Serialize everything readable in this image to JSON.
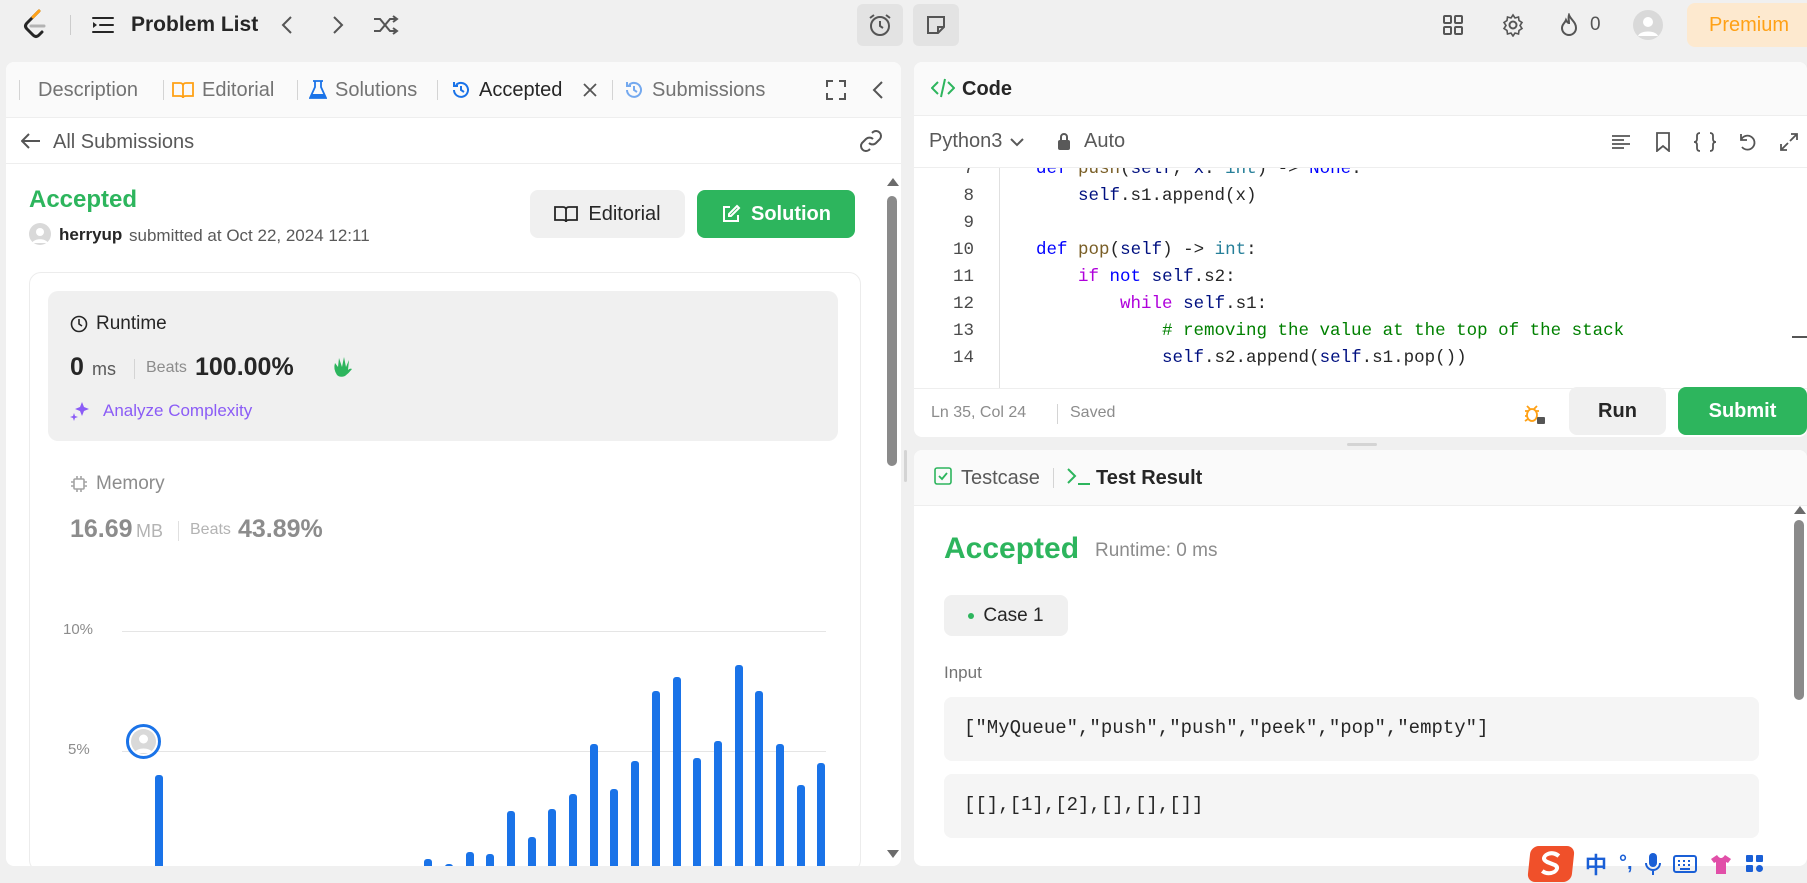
{
  "topbar": {
    "title": "Problem List",
    "streak": "0",
    "premium": "Premium"
  },
  "left_tabs": {
    "description": "Description",
    "editorial": "Editorial",
    "solutions": "Solutions",
    "accepted": "Accepted",
    "submissions": "Submissions"
  },
  "back": {
    "label": "All Submissions"
  },
  "submission": {
    "status": "Accepted",
    "user": "herryup",
    "submitted_text": "submitted at Oct 22, 2024 12:11",
    "editorial_btn": "Editorial",
    "solution_btn": "Solution"
  },
  "runtime": {
    "label": "Runtime",
    "value": "0",
    "unit": "ms",
    "beats_label": "Beats",
    "beats": "100.00%",
    "analyze": "Analyze Complexity"
  },
  "memory": {
    "label": "Memory",
    "value": "16.69",
    "unit": "MB",
    "beats_label": "Beats",
    "beats": "43.89%"
  },
  "chart_data": {
    "type": "bar",
    "y_ticks": [
      "10%",
      "5%"
    ],
    "ylim": [
      0,
      10
    ],
    "values": [
      4.0,
      0.2,
      0.2,
      0.2,
      0.2,
      0.2,
      0.2,
      0.2,
      0.2,
      0.2,
      0.2,
      0.2,
      0.2,
      0.5,
      0.3,
      0.8,
      0.7,
      2.5,
      1.4,
      2.6,
      3.2,
      5.3,
      3.4,
      4.6,
      7.5,
      8.1,
      4.7,
      5.4,
      8.6,
      7.5,
      5.3,
      3.6,
      4.5
    ]
  },
  "code": {
    "title": "Code",
    "language": "Python3",
    "mode": "Auto",
    "lines": [
      {
        "n": "7",
        "text": "    def push(self, x: int) -> None:"
      },
      {
        "n": "8",
        "text": "        self.s1.append(x)"
      },
      {
        "n": "9",
        "text": ""
      },
      {
        "n": "10",
        "text": "    def pop(self) -> int:"
      },
      {
        "n": "11",
        "text": "        if not self.s2:"
      },
      {
        "n": "12",
        "text": "            while self.s1:"
      },
      {
        "n": "13",
        "text": "                # removing the value at the top of the stack"
      },
      {
        "n": "14",
        "text": "                self.s2.append(self.s1.pop())"
      }
    ],
    "cursor": "Ln 35, Col 24",
    "saved": "Saved",
    "run": "Run",
    "submit": "Submit"
  },
  "result": {
    "testcase_tab": "Testcase",
    "result_tab": "Test Result",
    "status": "Accepted",
    "runtime": "Runtime: 0 ms",
    "case": "Case 1",
    "input_label": "Input",
    "input1": "[\"MyQueue\",\"push\",\"push\",\"peek\",\"pop\",\"empty\"]",
    "input2": "[[],[1],[2],[],[],[]]"
  },
  "ime": {
    "lang": "中",
    "punct": "°,"
  },
  "colors": {
    "green": "#2db55d",
    "blue": "#1a73e8",
    "orange": "#ffa116"
  }
}
